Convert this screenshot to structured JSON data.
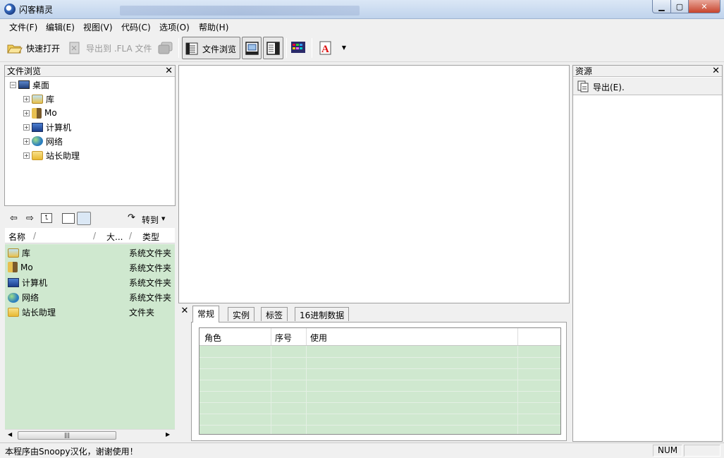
{
  "window": {
    "title": "闪客精灵"
  },
  "menu": [
    "文件(F)",
    "编辑(E)",
    "视图(V)",
    "代码(C)",
    "选项(O)",
    "帮助(H)"
  ],
  "toolbar": {
    "quick_open": "快速打开",
    "export_fla": "导出到 .FLA 文件",
    "file_browse": "文件浏览"
  },
  "file_browser": {
    "title": "文件浏览",
    "tree": {
      "root": "桌面",
      "children": [
        "库",
        "Mo",
        "计算机",
        "网络",
        "站长助理"
      ]
    },
    "nav": {
      "goto": "转到"
    },
    "columns": {
      "name": "名称",
      "size": "大...",
      "type": "类型"
    },
    "files": [
      {
        "name": "库",
        "type": "系统文件夹",
        "icon": "library-icon"
      },
      {
        "name": "Mo",
        "type": "系统文件夹",
        "icon": "user-folder-icon"
      },
      {
        "name": "计算机",
        "type": "系统文件夹",
        "icon": "computer-icon"
      },
      {
        "name": "网络",
        "type": "系统文件夹",
        "icon": "network-icon"
      },
      {
        "name": "站长助理",
        "type": "文件夹",
        "icon": "folder-icon"
      }
    ]
  },
  "properties": {
    "tabs": [
      "常规",
      "实例",
      "标签",
      "16进制数据"
    ],
    "active_tab": "常规",
    "columns": [
      "角色",
      "序号",
      "使用"
    ]
  },
  "resources": {
    "title": "资源",
    "export": "导出(E)."
  },
  "status": {
    "message": "本程序由Snoopy汉化，谢谢使用！",
    "num": "NUM"
  },
  "colors": {
    "list_bg": "#cfe8cf",
    "titlebar": "#bfd3ec",
    "close_red": "#c7442c"
  }
}
